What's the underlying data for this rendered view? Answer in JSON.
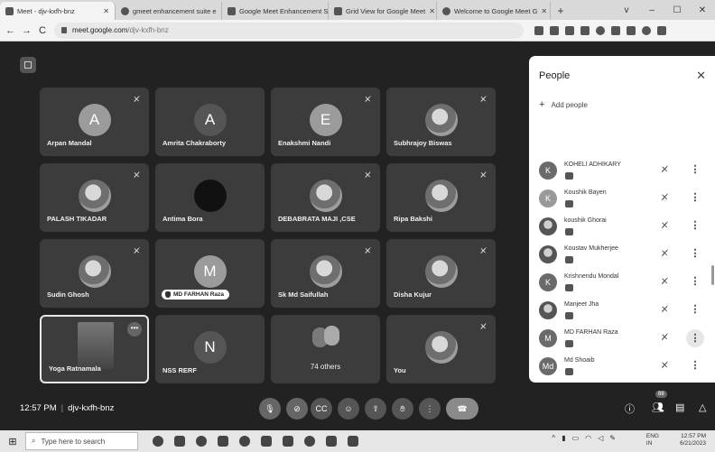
{
  "browser": {
    "tabs": [
      {
        "title": "Meet - djv-kxfh-bnz",
        "active": true
      },
      {
        "title": "gmeet enhancement suite e"
      },
      {
        "title": "Google Meet Enhancement S"
      },
      {
        "title": "Grid View for Google Meet"
      },
      {
        "title": "Welcome to Google Meet G"
      }
    ],
    "new_tab": "+",
    "window_controls": [
      "v",
      "–",
      "☐",
      "✕"
    ],
    "url_host": "meet.google.com",
    "url_path": "/djv-kxfh-bnz"
  },
  "meeting": {
    "time": "12:57 PM",
    "code": "djv-kxfh-bnz",
    "participant_badge": "88"
  },
  "tiles": [
    {
      "name": "Arpan Mandal",
      "initial": "A",
      "kind": "letter"
    },
    {
      "name": "Amrita Chakraborty",
      "initial": "A",
      "kind": "letter"
    },
    {
      "name": "Enakshmi Nandi",
      "initial": "E",
      "kind": "letter"
    },
    {
      "name": "Subhrajoy Biswas",
      "kind": "photo"
    },
    {
      "name": "PALASH TIKADAR",
      "kind": "photo"
    },
    {
      "name": "Antima Bora",
      "kind": "dark"
    },
    {
      "name": "DEBABRATA MAJI ,CSE",
      "kind": "photo"
    },
    {
      "name": "Ripa Bakshi",
      "kind": "photo"
    },
    {
      "name": "Sudin Ghosh",
      "kind": "photo"
    },
    {
      "name": "MD FARHAN Raza",
      "initial": "M",
      "kind": "letter",
      "speaking": true
    },
    {
      "name": "Sk Md Saifullah",
      "kind": "photo"
    },
    {
      "name": "Disha Kujur",
      "kind": "photo"
    },
    {
      "name": "Yoga Ratnamala",
      "kind": "yoga"
    },
    {
      "name": "NSS RERF",
      "initial": "N",
      "kind": "letter"
    },
    {
      "name": "74 others",
      "kind": "others"
    },
    {
      "name": "You",
      "kind": "photo"
    }
  ],
  "people_panel": {
    "title": "People",
    "add_label": "Add people",
    "people": [
      {
        "name": "KOHELI ADHIKARY",
        "initial": "K"
      },
      {
        "name": "Koushik Bayen",
        "initial": "K"
      },
      {
        "name": "koushik Ghorai",
        "initial": ""
      },
      {
        "name": "Koustav Mukherjee",
        "initial": ""
      },
      {
        "name": "Krishnendu Mondal",
        "initial": "K"
      },
      {
        "name": "Manjeet Jha",
        "initial": ""
      },
      {
        "name": "MD FARHAN Raza",
        "initial": "M"
      },
      {
        "name": "Md Shoaib",
        "initial": "Md"
      }
    ]
  },
  "taskbar": {
    "search_placeholder": "Type here to search",
    "lang_top": "ENG",
    "lang_bottom": "IN",
    "time": "12:57 PM",
    "date": "6/21/2023"
  }
}
